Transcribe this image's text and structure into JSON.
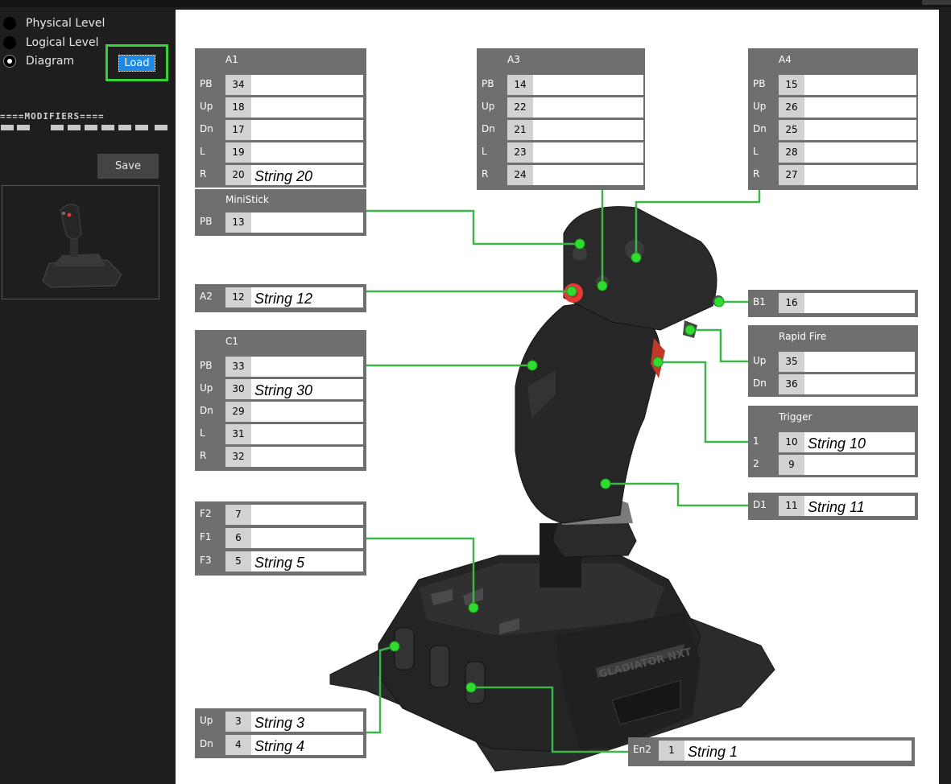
{
  "sidebar": {
    "modes": [
      {
        "label": "Physical Level",
        "checked": false
      },
      {
        "label": "Logical Level",
        "checked": false
      },
      {
        "label": "Diagram",
        "checked": true
      }
    ],
    "load_label": "Load",
    "modifiers_label": "====MODIFIERS====",
    "save_label": "Save"
  },
  "panels": {
    "a1": {
      "title": "A1",
      "rows": [
        {
          "label": "PB",
          "num": "34",
          "text": ""
        },
        {
          "label": "Up",
          "num": "18",
          "text": ""
        },
        {
          "label": "Dn",
          "num": "17",
          "text": ""
        },
        {
          "label": "L",
          "num": "19",
          "text": ""
        },
        {
          "label": "R",
          "num": "20",
          "text": "String 20"
        }
      ]
    },
    "ministick": {
      "title": "MiniStick",
      "rows": [
        {
          "label": "PB",
          "num": "13",
          "text": ""
        }
      ]
    },
    "a3": {
      "title": "A3",
      "rows": [
        {
          "label": "PB",
          "num": "14",
          "text": ""
        },
        {
          "label": "Up",
          "num": "22",
          "text": ""
        },
        {
          "label": "Dn",
          "num": "21",
          "text": ""
        },
        {
          "label": "L",
          "num": "23",
          "text": ""
        },
        {
          "label": "R",
          "num": "24",
          "text": ""
        }
      ]
    },
    "a4": {
      "title": "A4",
      "rows": [
        {
          "label": "PB",
          "num": "15",
          "text": ""
        },
        {
          "label": "Up",
          "num": "26",
          "text": ""
        },
        {
          "label": "Dn",
          "num": "25",
          "text": ""
        },
        {
          "label": "L",
          "num": "28",
          "text": ""
        },
        {
          "label": "R",
          "num": "27",
          "text": ""
        }
      ]
    },
    "a2": {
      "rows": [
        {
          "label": "A2",
          "num": "12",
          "text": "String 12"
        }
      ]
    },
    "b1": {
      "rows": [
        {
          "label": "B1",
          "num": "16",
          "text": ""
        }
      ]
    },
    "rapid": {
      "title": "Rapid Fire",
      "rows": [
        {
          "label": "Up",
          "num": "35",
          "text": ""
        },
        {
          "label": "Dn",
          "num": "36",
          "text": ""
        }
      ]
    },
    "c1": {
      "title": "C1",
      "rows": [
        {
          "label": "PB",
          "num": "33",
          "text": ""
        },
        {
          "label": "Up",
          "num": "30",
          "text": "String 30"
        },
        {
          "label": "Dn",
          "num": "29",
          "text": ""
        },
        {
          "label": "L",
          "num": "31",
          "text": ""
        },
        {
          "label": "R",
          "num": "32",
          "text": ""
        }
      ]
    },
    "trigger": {
      "title": "Trigger",
      "rows": [
        {
          "label": "1",
          "num": "10",
          "text": "String 10"
        },
        {
          "label": "2",
          "num": "9",
          "text": ""
        }
      ]
    },
    "d1": {
      "rows": [
        {
          "label": "D1",
          "num": "11",
          "text": "String 11"
        }
      ]
    },
    "f": {
      "rows": [
        {
          "label": "F2",
          "num": "7",
          "text": ""
        },
        {
          "label": "F1",
          "num": "6",
          "text": ""
        },
        {
          "label": "F3",
          "num": "5",
          "text": "String 5"
        }
      ]
    },
    "updn": {
      "rows": [
        {
          "label": "Up",
          "num": "3",
          "text": "String 3"
        },
        {
          "label": "Dn",
          "num": "4",
          "text": "String 4"
        }
      ]
    },
    "en2": {
      "rows": [
        {
          "label": "En2",
          "num": "1",
          "text": "String 1"
        }
      ]
    }
  },
  "joystick": {
    "base_label": "GLADIATOR NXT"
  },
  "colors": {
    "connector": "#3cb54a",
    "dot": "#2fdc2f",
    "panel": "#6f6f6f",
    "num_bg": "#d2d2d2",
    "accent_red": "#e53935",
    "load_blue": "#1e88e5",
    "highlight": "#35d337"
  }
}
